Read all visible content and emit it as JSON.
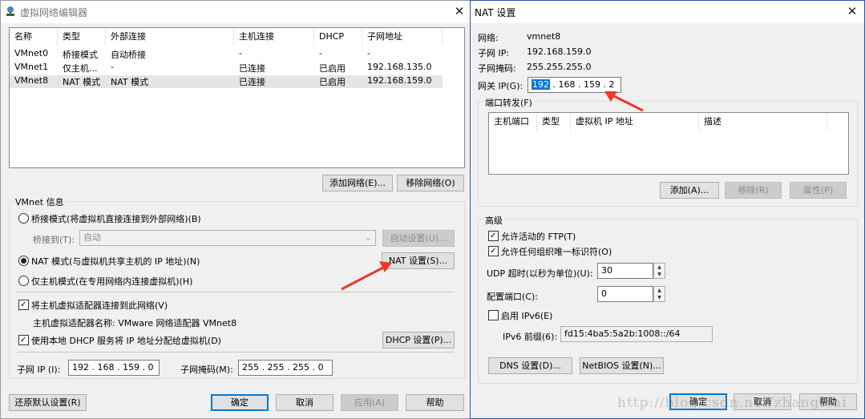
{
  "left_window": {
    "title": "虚拟网络编辑器",
    "columns": [
      "名称",
      "类型",
      "外部连接",
      "主机连接",
      "DHCP",
      "子网地址"
    ],
    "rows": [
      [
        "VMnet0",
        "桥接模式",
        "自动桥接",
        "-",
        "-",
        "-"
      ],
      [
        "VMnet1",
        "仅主机...",
        "-",
        "已连接",
        "已启用",
        "192.168.135.0"
      ],
      [
        "VMnet8",
        "NAT 模式",
        "NAT 模式",
        "已连接",
        "已启用",
        "192.168.159.0"
      ]
    ],
    "add_network": "添加网络(E)...",
    "remove_network": "移除网络(O)",
    "vmnet_info": "VMnet 信息",
    "bridge_radio": "桥接模式(将虚拟机直接连接到外部网络)(B)",
    "bridged_to_label": "桥接到(T):",
    "bridged_to_value": "自动",
    "auto_settings": "自动设置(U)...",
    "nat_radio": "NAT 模式(与虚拟机共享主机的 IP 地址)(N)",
    "nat_settings": "NAT 设置(S)...",
    "hostonly_radio": "仅主机模式(在专用网络内连接虚拟机)(H)",
    "connect_adapter": "将主机虚拟适配器连接到此网络(V)",
    "adapter_name": "主机虚拟适配器名称: VMware 网络适配器 VMnet8",
    "use_dhcp": "使用本地 DHCP 服务将 IP 地址分配给虚拟机(D)",
    "dhcp_settings": "DHCP 设置(P)...",
    "subnet_ip_label": "子网 IP (I):",
    "subnet_ip": "192 . 168 . 159 . 0",
    "subnet_mask_label": "子网掩码(M):",
    "subnet_mask": "255 . 255 . 255 . 0",
    "restore_defaults": "还原默认设置(R)",
    "ok": "确定",
    "cancel": "取消",
    "apply": "应用(A)",
    "help": "帮助"
  },
  "nat_window": {
    "title": "NAT 设置",
    "network_label": "网络:",
    "network_value": "vmnet8",
    "subnet_ip_label": "子网 IP:",
    "subnet_ip_value": "192.168.159.0",
    "subnet_mask_label": "子网掩码:",
    "subnet_mask_value": "255.255.255.0",
    "gateway_label": "网关 IP(G):",
    "gateway_selected": "192",
    "gateway_rest": ". 168 . 159 . 2",
    "port_forwarding": "端口转发(F)",
    "pf_columns": [
      "主机端口",
      "类型",
      "虚拟机 IP 地址",
      "描述"
    ],
    "add": "添加(A)...",
    "remove": "移除(R)",
    "properties": "属性(P)",
    "advanced": "高级",
    "allow_ftp": "允许活动的 FTP(T)",
    "allow_any_oui": "允许任何组织唯一标识符(O)",
    "udp_timeout_label": "UDP 超时(以秒为单位)(U):",
    "udp_timeout": "30",
    "config_port_label": "配置端口(C):",
    "config_port": "0",
    "enable_ipv6": "启用 IPv6(E)",
    "ipv6_prefix_label": "IPv6 前缀(6):",
    "ipv6_prefix": "fd15:4ba5:5a2b:1008::/64",
    "dns_settings": "DNS 设置(D)...",
    "netbios_settings": "NetBIOS 设置(N)...",
    "ok": "确定",
    "cancel": "取消",
    "help": "帮助"
  },
  "watermark": "http://blog.csdn.net/zhangHui",
  "colors": {
    "arrow": "#e8392b",
    "selection": "#0078d7"
  }
}
